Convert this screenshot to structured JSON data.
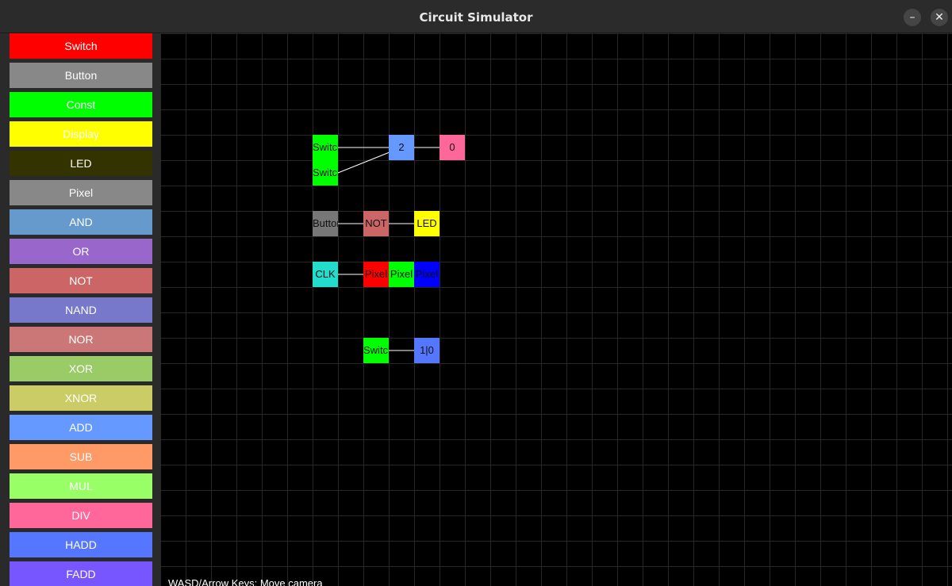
{
  "window": {
    "title": "Circuit Simulator",
    "minimize_glyph": "–",
    "close_glyph": "✕"
  },
  "sidebar": {
    "items": [
      {
        "label": "Switch",
        "color": "#ff0000"
      },
      {
        "label": "Button",
        "color": "#888888"
      },
      {
        "label": "Const",
        "color": "#00ff00"
      },
      {
        "label": "Display",
        "color": "#ffff00"
      },
      {
        "label": "LED",
        "color": "#333300"
      },
      {
        "label": "Pixel",
        "color": "#888888"
      },
      {
        "label": "AND",
        "color": "#6699cc"
      },
      {
        "label": "OR",
        "color": "#9966cc"
      },
      {
        "label": "NOT",
        "color": "#cc6666"
      },
      {
        "label": "NAND",
        "color": "#7777cc"
      },
      {
        "label": "NOR",
        "color": "#cc7777"
      },
      {
        "label": "XOR",
        "color": "#99cc66"
      },
      {
        "label": "XNOR",
        "color": "#cccc66"
      },
      {
        "label": "ADD",
        "color": "#6699ff"
      },
      {
        "label": "SUB",
        "color": "#ff9966"
      },
      {
        "label": "MUL",
        "color": "#99ff66"
      },
      {
        "label": "DIV",
        "color": "#ff6699"
      },
      {
        "label": "HADD",
        "color": "#5577ff"
      },
      {
        "label": "FADD",
        "color": "#7755ff"
      }
    ]
  },
  "canvas": {
    "components": [
      {
        "label": "Switch",
        "color": "#00ff00"
      },
      {
        "label": "Switch",
        "color": "#00ff00"
      },
      {
        "label": "2",
        "color": "#6699ff"
      },
      {
        "label": "0",
        "color": "#ff6699"
      },
      {
        "label": "Button",
        "color": "#777777"
      },
      {
        "label": "NOT",
        "color": "#cc6666"
      },
      {
        "label": "LED",
        "color": "#ffff00"
      },
      {
        "label": "CLK",
        "color": "#22ddcc"
      },
      {
        "label": "Pixel",
        "color": "#ff0000"
      },
      {
        "label": "Pixel",
        "color": "#00ff00"
      },
      {
        "label": "Pixel",
        "color": "#0000ff"
      },
      {
        "label": "Switch",
        "color": "#00ff00"
      },
      {
        "label": "1|0",
        "color": "#5577ff"
      }
    ],
    "help_text": "WASD/Arrow Keys: Move camera"
  }
}
